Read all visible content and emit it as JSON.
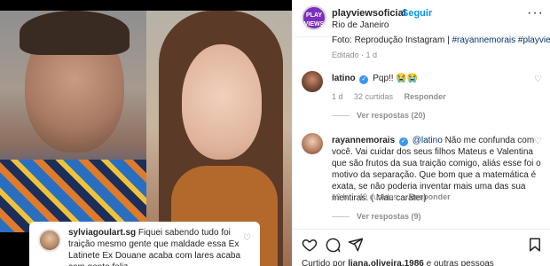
{
  "post": {
    "username": "playviewsoficial",
    "follow_label": "Seguir",
    "location": "Rio de Janeiro",
    "avatar_text": "PLAY VIEWS",
    "caption_tail_prefix": "Foto: Reprodução Instagram | ",
    "caption_tags": "#rayannemorais #playviews",
    "edited_label": "Editado · 1 d"
  },
  "image_comment": {
    "username": "sylviagoulart.sg",
    "text": "Fiquei sabendo tudo foi traição mesmo gente que maldade essa Ex Latinete Ex Douane acaba com lares acaba com gente feliz .."
  },
  "comments": [
    {
      "username": "latino",
      "text": "Pqp!! 😭😭",
      "time": "1 d",
      "likes": "32 curtidas",
      "reply_label": "Responder",
      "view_replies": "Ver respostas (20)"
    },
    {
      "username": "rayannemorais",
      "mention": "@latino",
      "text": "Não me confunda com você. Vai cuidar dos seus filhos Mateus e Valentina que são frutos da sua traição comigo, aliás esse foi o motivo da separação. Que bom que a matemática é exata, se não poderia inventar mais uma das sua mentiras. ( Mau caráter)",
      "time": "13 h",
      "likes": "40 curtidas",
      "reply_label": "Responder",
      "view_replies": "Ver respostas (9)"
    }
  ],
  "footer": {
    "liked_by_prefix": "Curtido por ",
    "liked_by_user": "liana.oliveira.1986",
    "liked_by_suffix": " e outras pessoas"
  },
  "icons": {
    "more": "more-options-icon",
    "heart": "heart-icon",
    "comment": "comment-icon",
    "share": "share-icon",
    "save": "bookmark-icon",
    "verified": "verified-badge-icon"
  },
  "colors": {
    "accent": "#0095f6",
    "verified": "#3897f0",
    "mention": "#00376b"
  }
}
